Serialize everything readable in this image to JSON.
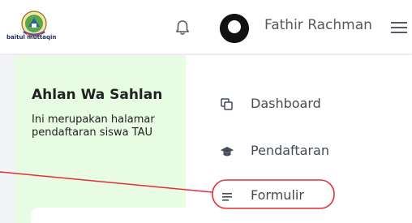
{
  "header": {
    "logo_text": "baitul muttaqin",
    "notification_icon": "bell-icon",
    "user_name": "Fathir Rachman",
    "menu_icon": "hamburger-menu-icon"
  },
  "welcome": {
    "title": "Ahlan Wa Sahlan",
    "line1": "Ini merupakan halamar",
    "line2": "pendaftaran siswa TAU"
  },
  "dropdown": {
    "items": [
      {
        "label": "Dashboard",
        "icon": "dashboard-icon"
      },
      {
        "label": "Pendaftaran",
        "icon": "graduation-cap-icon"
      },
      {
        "label": "Formulir",
        "icon": "list-icon"
      }
    ]
  },
  "colors": {
    "welcome_bg": "#e8fbe3",
    "annotation": "#e0303a",
    "text": "#444b55"
  }
}
